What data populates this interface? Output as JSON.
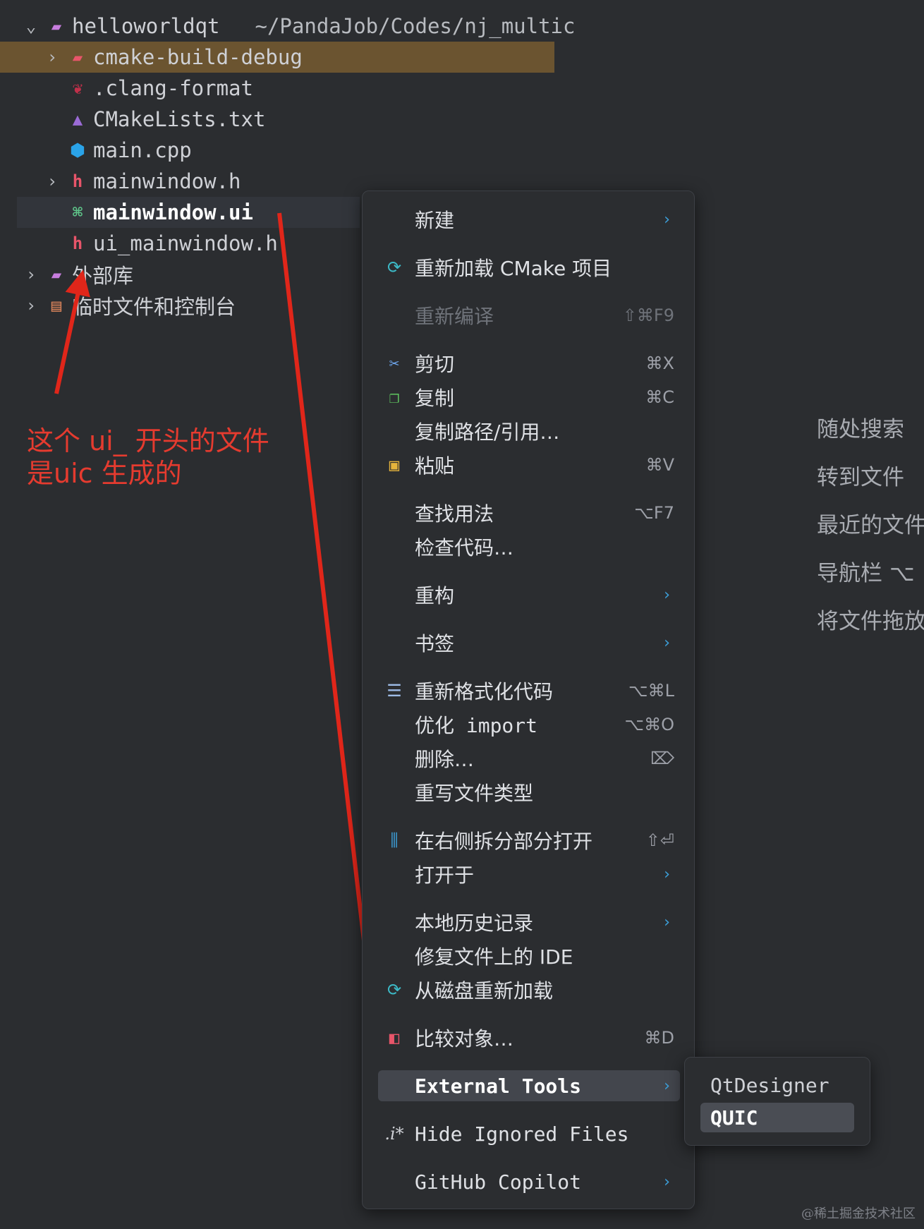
{
  "tree": {
    "project_name": "helloworldqt",
    "project_path": "~/PandaJob/Codes/nj_multic",
    "items": [
      {
        "label": "cmake-build-debug",
        "icon": "folder-icon"
      },
      {
        "label": ".clang-format",
        "icon": "clang-format-icon"
      },
      {
        "label": "CMakeLists.txt",
        "icon": "cmake-icon"
      },
      {
        "label": "main.cpp",
        "icon": "cpp-file-icon"
      },
      {
        "label": "mainwindow.h",
        "icon": "header-file-icon"
      },
      {
        "label": "mainwindow.ui",
        "icon": "ui-file-icon"
      },
      {
        "label": "ui_mainwindow.h",
        "icon": "header-file-icon"
      },
      {
        "label": "外部库",
        "icon": "library-icon"
      },
      {
        "label": "临时文件和控制台",
        "icon": "scratch-icon"
      }
    ]
  },
  "annotation": {
    "line1": "这个 ui_ 开头的文件",
    "line2": "是uic 生成的",
    "color": "#e53b2f"
  },
  "menu": {
    "items": [
      {
        "label": "新建",
        "shortcut": "",
        "submenu": true
      },
      {
        "label": "重新加载 CMake 项目",
        "shortcut": "",
        "icon": "reload-icon"
      },
      {
        "label": "重新编译",
        "shortcut": "⇧⌘F9",
        "disabled": true
      },
      {
        "label": "剪切",
        "shortcut": "⌘X",
        "icon": "scissors-icon"
      },
      {
        "label": "复制",
        "shortcut": "⌘C",
        "icon": "copy-icon"
      },
      {
        "label": "复制路径/引用…",
        "shortcut": ""
      },
      {
        "label": "粘贴",
        "shortcut": "⌘V",
        "icon": "clipboard-icon"
      },
      {
        "label": "查找用法",
        "shortcut": "⌥F7"
      },
      {
        "label": "检查代码…",
        "shortcut": ""
      },
      {
        "label": "重构",
        "shortcut": "",
        "submenu": true
      },
      {
        "label": "书签",
        "shortcut": "",
        "submenu": true
      },
      {
        "label": "重新格式化代码",
        "shortcut": "⌥⌘L",
        "icon": "reformat-icon"
      },
      {
        "label": "优化 import",
        "shortcut": "⌥⌘O"
      },
      {
        "label": "删除…",
        "shortcut": "⌦"
      },
      {
        "label": "重写文件类型",
        "shortcut": ""
      },
      {
        "label": "在右侧拆分部分打开",
        "shortcut": "⇧⏎",
        "icon": "split-icon"
      },
      {
        "label": "打开于",
        "shortcut": "",
        "submenu": true
      },
      {
        "label": "本地历史记录",
        "shortcut": "",
        "submenu": true
      },
      {
        "label": "修复文件上的 IDE",
        "shortcut": ""
      },
      {
        "label": "从磁盘重新加载",
        "shortcut": "",
        "icon": "reload-icon"
      },
      {
        "label": "比较对象…",
        "shortcut": "⌘D",
        "icon": "compare-icon"
      },
      {
        "label": "External Tools",
        "shortcut": "",
        "submenu": true,
        "active": true
      },
      {
        "label": "Hide Ignored Files",
        "shortcut": "",
        "icon": "ignored-files-icon"
      },
      {
        "label": "GitHub Copilot",
        "shortcut": "",
        "submenu": true
      }
    ]
  },
  "submenu": {
    "items": [
      {
        "label": "QtDesigner"
      },
      {
        "label": "QUIC",
        "active": true
      }
    ]
  },
  "hints": {
    "items": [
      "随处搜索",
      "转到文件",
      "最近的文件",
      "导航栏 ⌥",
      "将文件拖放"
    ]
  },
  "watermark": "@稀土掘金技术社区"
}
